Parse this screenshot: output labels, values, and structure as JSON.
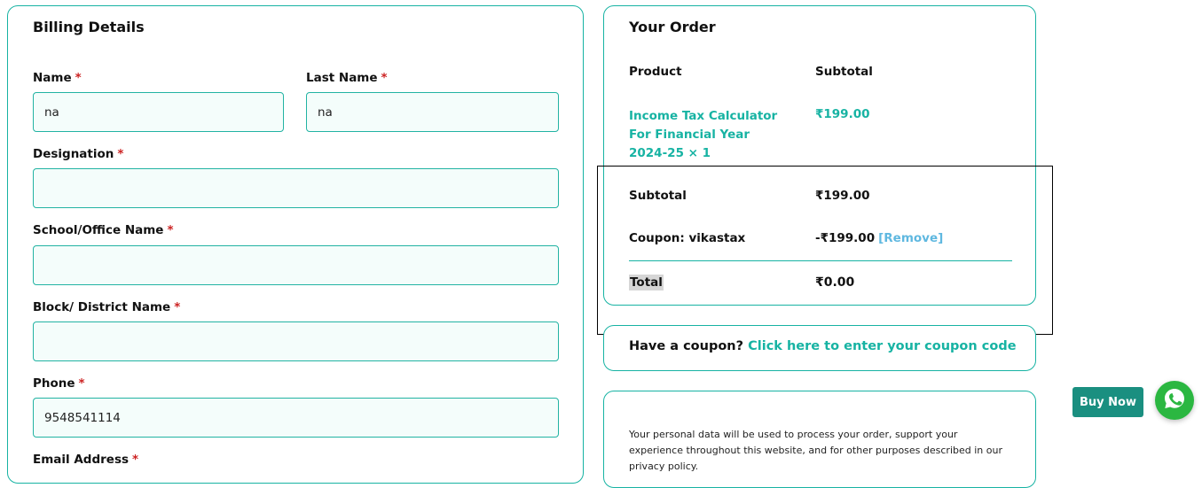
{
  "billing": {
    "title": "Billing Details",
    "required_mark": "*",
    "fields": {
      "name": {
        "label": "Name",
        "value": "na"
      },
      "last_name": {
        "label": "Last Name",
        "value": "na"
      },
      "designation": {
        "label": "Designation",
        "value": ""
      },
      "school": {
        "label": "School/Office Name",
        "value": ""
      },
      "block": {
        "label": "Block/ District Name",
        "value": ""
      },
      "phone": {
        "label": "Phone",
        "value": "9548541114"
      },
      "email": {
        "label": "Email Address",
        "value": ""
      }
    }
  },
  "order": {
    "title": "Your Order",
    "col_product": "Product",
    "col_subtotal": "Subtotal",
    "product_name": "Income Tax Calculator For Financial Year 2024-25",
    "product_qty": "× 1",
    "product_price": "₹199.00",
    "subtotal_label": "Subtotal",
    "subtotal_value": "₹199.00",
    "coupon_label": "Coupon: vikastax",
    "coupon_value": "-₹199.00",
    "coupon_remove": "[Remove]",
    "total_label": "Total",
    "total_value": "₹0.00"
  },
  "coupon": {
    "prompt": "Have a coupon?",
    "link": "Click here to enter your coupon code"
  },
  "privacy": {
    "text": "Your personal data will be used to process your order, support your experience throughout this website, and for other purposes described in our privacy policy."
  },
  "floating": {
    "buy_now": "Buy Now"
  },
  "colors": {
    "accent": "#17b3a3",
    "required": "#cc2222",
    "link_blue": "#5fb8e0",
    "whatsapp": "#2bb741",
    "buy_now_bg": "#1a8f80"
  },
  "icons": {
    "whatsapp": "whatsapp-icon"
  }
}
